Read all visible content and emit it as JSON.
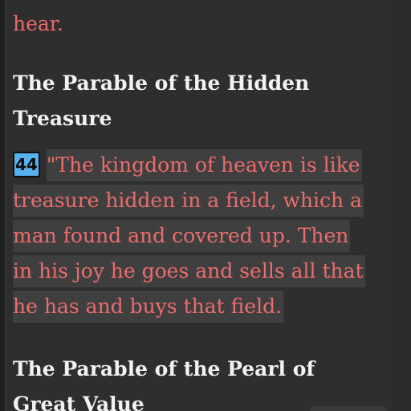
{
  "reader": {
    "previous_text": "hear.",
    "sections": [
      {
        "heading_lines": [
          "The Parable of the Hidden",
          "Treasure"
        ]
      },
      {
        "heading_lines": [
          "The Parable of the Pearl of",
          "Great Value"
        ]
      }
    ],
    "verse": {
      "number": "44",
      "lines": [
        "\"The kingdom of heaven is like",
        "treasure hidden in a field, which a",
        "man found and covered up. Then",
        "in his joy he goes and sells all that",
        "he has and buys that field."
      ]
    }
  }
}
